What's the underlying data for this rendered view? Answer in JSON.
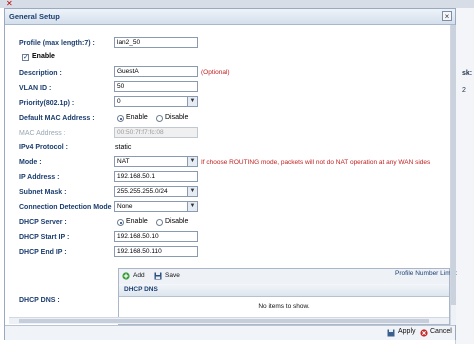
{
  "window": {
    "title": "General Setup",
    "close_glyph": "×"
  },
  "background": {
    "right_label_1": "sk:",
    "right_label_2": "2"
  },
  "form": {
    "profile": {
      "label": "Profile (max length:7) :",
      "value": "lan2_50"
    },
    "enable": {
      "label": "Enable",
      "checked": true
    },
    "description": {
      "label": "Description :",
      "value": "GuestA",
      "note": "(Optional)"
    },
    "vlan_id": {
      "label": "VLAN ID :",
      "value": "50"
    },
    "priority": {
      "label": "Priority(802.1p) :",
      "value": "0"
    },
    "default_mac": {
      "label": "Default MAC Address :",
      "options": [
        "Enable",
        "Disable"
      ],
      "selected": "Enable"
    },
    "mac_address": {
      "label": "MAC Address :",
      "value": "00:50:7f:f7:fc:08"
    },
    "ipv4_protocol": {
      "label": "IPv4 Protocol :",
      "value": "static"
    },
    "mode": {
      "label": "Mode :",
      "value": "NAT",
      "note": "If choose ROUTING mode, packets will not do NAT operation at any WAN sides"
    },
    "ip_address": {
      "label": "IP Address :",
      "value": "192.168.50.1"
    },
    "subnet_mask": {
      "label": "Subnet Mask :",
      "value": "255.255.255.0/24"
    },
    "connection_detection": {
      "label": "Connection Detection Mode :",
      "value": "None"
    },
    "dhcp_server": {
      "label": "DHCP Server :",
      "options": [
        "Enable",
        "Disable"
      ],
      "selected": "Enable"
    },
    "dhcp_start": {
      "label": "DHCP Start IP :",
      "value": "192.168.50.10"
    },
    "dhcp_end": {
      "label": "DHCP End IP :",
      "value": "192.168.50.110"
    },
    "dhcp_dns": {
      "label": "DHCP DNS :",
      "add_label": "Add",
      "save_label": "Save",
      "limit_label": "Profile Number Limit :",
      "column": "DHCP DNS",
      "empty": "No items to show."
    }
  },
  "footer": {
    "apply_label": "Apply",
    "cancel_label": "Cancel"
  },
  "colors": {
    "accent": "#1c3f72",
    "note": "#c02020"
  }
}
